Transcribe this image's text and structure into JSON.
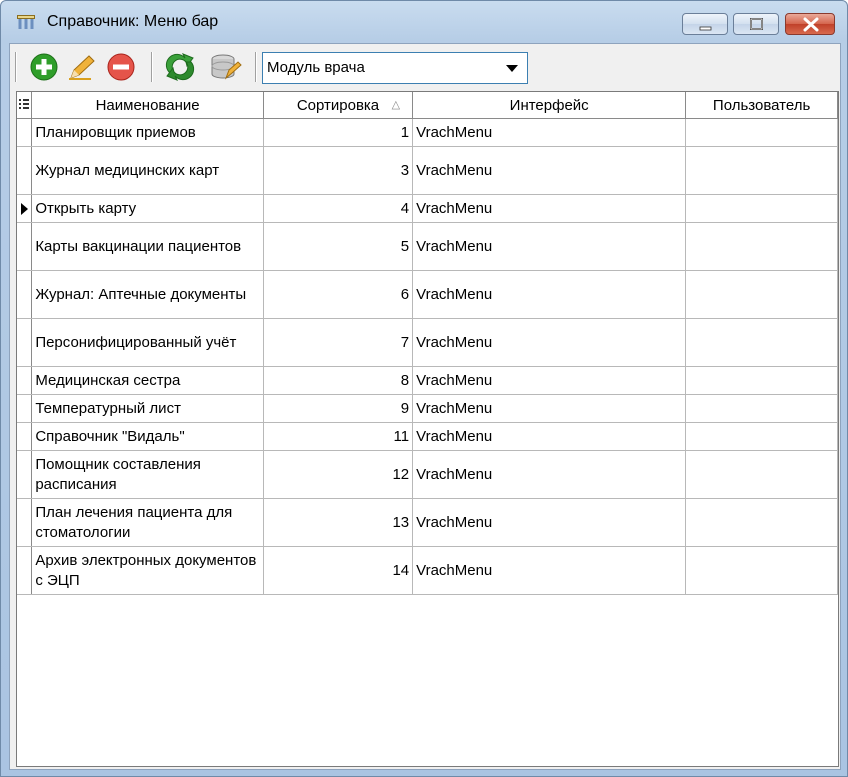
{
  "window": {
    "title": "Справочник: Меню бар"
  },
  "toolbar": {
    "buttons": [
      "add-icon",
      "edit-icon",
      "delete-icon",
      "refresh-icon",
      "database-icon"
    ],
    "module_select": {
      "value": "Модуль врача"
    }
  },
  "grid": {
    "columns": [
      "Наименование",
      "Сортировка",
      "Интерфейс",
      "Пользователь"
    ],
    "sort_column": "Сортировка",
    "current_row": 2,
    "rows": [
      {
        "name": "Планировщик приемов",
        "sort": "1",
        "interface": "VrachMenu",
        "user": ""
      },
      {
        "name": "Журнал медицинских карт",
        "sort": "3",
        "interface": "VrachMenu",
        "user": ""
      },
      {
        "name": "Открыть карту",
        "sort": "4",
        "interface": "VrachMenu",
        "user": ""
      },
      {
        "name": "Карты вакцинации пациентов",
        "sort": "5",
        "interface": "VrachMenu",
        "user": ""
      },
      {
        "name": "Журнал: Аптечные документы",
        "sort": "6",
        "interface": "VrachMenu",
        "user": ""
      },
      {
        "name": "Персонифицированный учёт",
        "sort": "7",
        "interface": "VrachMenu",
        "user": ""
      },
      {
        "name": "Медицинская сестра",
        "sort": "8",
        "interface": "VrachMenu",
        "user": ""
      },
      {
        "name": "Температурный лист",
        "sort": "9",
        "interface": "VrachMenu",
        "user": ""
      },
      {
        "name": "Справочник \"Видаль\"",
        "sort": "11",
        "interface": "VrachMenu",
        "user": ""
      },
      {
        "name": "Помощник составления расписания",
        "sort": "12",
        "interface": "VrachMenu",
        "user": ""
      },
      {
        "name": "План лечения пациента для стоматологии",
        "sort": "13",
        "interface": "VrachMenu",
        "user": ""
      },
      {
        "name": "Архив электронных документов с ЭЦП",
        "sort": "14",
        "interface": "VrachMenu",
        "user": ""
      }
    ]
  }
}
